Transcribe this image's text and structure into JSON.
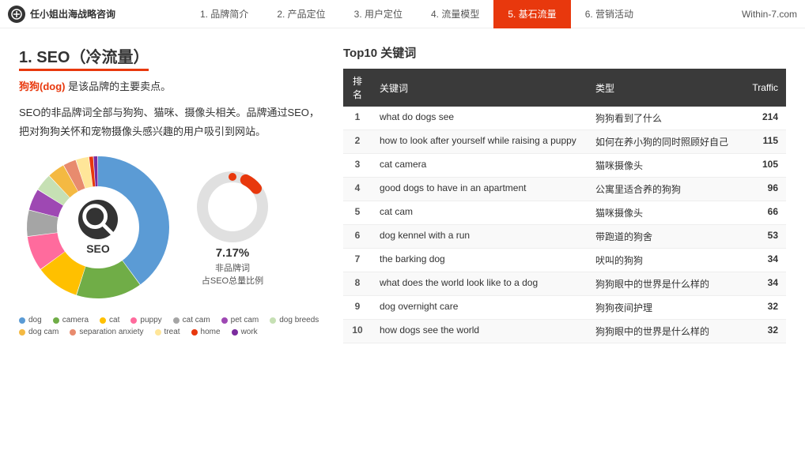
{
  "nav": {
    "logo_text": "任小姐出海战略咨询",
    "items": [
      {
        "label": "1. 品牌简介",
        "active": false
      },
      {
        "label": "2. 产品定位",
        "active": false
      },
      {
        "label": "3. 用户定位",
        "active": false
      },
      {
        "label": "4. 流量模型",
        "active": false
      },
      {
        "label": "5. 基石流量",
        "active": true
      },
      {
        "label": "6. 营销活动",
        "active": false
      }
    ],
    "site": "Within-7.com"
  },
  "left": {
    "section_title": "1. SEO（冷流量）",
    "desc1": "狗狗(dog) 是该品牌的主要卖点。",
    "desc2": "SEO的非品牌词全部与狗狗、猫咪、摄像头相关。品牌通过SEO，把对狗狗关怀和宠物摄像头感兴趣的用户吸引到网站。",
    "highlight": "狗狗(dog)",
    "chart_center_label": "SEO",
    "small_donut_pct": "7.17%",
    "small_donut_label1": "非品牌词",
    "small_donut_label2": "占SEO总量比例",
    "legend": [
      {
        "color": "#5b9bd5",
        "label": "dog"
      },
      {
        "color": "#70ad47",
        "label": "camera"
      },
      {
        "color": "#ffc000",
        "label": "cat"
      },
      {
        "color": "#ff6b9d",
        "label": "puppy"
      },
      {
        "color": "#a5a5a5",
        "label": "cat cam"
      },
      {
        "color": "#9e48b3",
        "label": "pet cam"
      },
      {
        "color": "#c6e0b4",
        "label": "dog breeds"
      },
      {
        "color": "#f4b942",
        "label": "dog cam"
      },
      {
        "color": "#e88b6e",
        "label": "separation anxiety"
      },
      {
        "color": "#ffe699",
        "label": "treat"
      },
      {
        "color": "#e8380d",
        "label": "home"
      },
      {
        "color": "#7b2c9e",
        "label": "work"
      }
    ],
    "donut_segments": [
      {
        "color": "#5b9bd5",
        "pct": 40
      },
      {
        "color": "#70ad47",
        "pct": 15
      },
      {
        "color": "#ffc000",
        "pct": 10
      },
      {
        "color": "#ff6b9d",
        "pct": 8
      },
      {
        "color": "#a5a5a5",
        "pct": 6
      },
      {
        "color": "#9e48b3",
        "pct": 5
      },
      {
        "color": "#c6e0b4",
        "pct": 4
      },
      {
        "color": "#f4b942",
        "pct": 4
      },
      {
        "color": "#e88b6e",
        "pct": 3
      },
      {
        "color": "#ffe699",
        "pct": 3
      },
      {
        "color": "#e8380d",
        "pct": 1
      },
      {
        "color": "#7b2c9e",
        "pct": 1
      }
    ]
  },
  "right": {
    "top10_title": "Top10 关键词",
    "table_headers": [
      "排名",
      "关键词",
      "类型",
      "Traffic"
    ],
    "rows": [
      {
        "rank": "1",
        "keyword": "what do dogs see",
        "type": "狗狗看到了什么",
        "traffic": "214"
      },
      {
        "rank": "2",
        "keyword": "how to look after yourself while raising a puppy",
        "type": "如何在养小狗的同时照顾好自己",
        "traffic": "115"
      },
      {
        "rank": "3",
        "keyword": "cat camera",
        "type": "猫咪摄像头",
        "traffic": "105"
      },
      {
        "rank": "4",
        "keyword": "good dogs to have in an apartment",
        "type": "公寓里适合养的狗狗",
        "traffic": "96"
      },
      {
        "rank": "5",
        "keyword": "cat cam",
        "type": "猫咪摄像头",
        "traffic": "66"
      },
      {
        "rank": "6",
        "keyword": "dog kennel with a run",
        "type": "带跑道的狗舍",
        "traffic": "53"
      },
      {
        "rank": "7",
        "keyword": "the barking dog",
        "type": "吠叫的狗狗",
        "traffic": "34"
      },
      {
        "rank": "8",
        "keyword": "what does the world look like to a dog",
        "type": "狗狗眼中的世界是什么样的",
        "traffic": "34"
      },
      {
        "rank": "9",
        "keyword": "dog overnight care",
        "type": "狗狗夜间护理",
        "traffic": "32"
      },
      {
        "rank": "10",
        "keyword": "how dogs see the world",
        "type": "狗狗眼中的世界是什么样的",
        "traffic": "32"
      }
    ]
  }
}
